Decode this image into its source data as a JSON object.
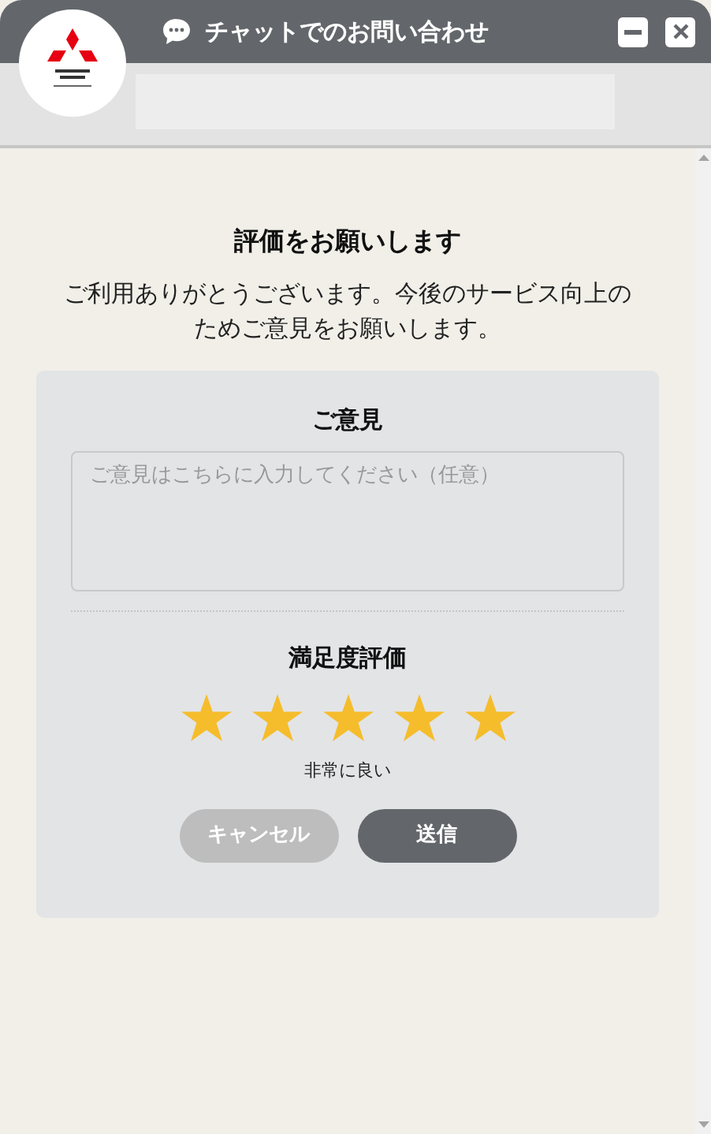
{
  "window": {
    "title": "チャットでのお問い合わせ"
  },
  "survey": {
    "title": "評価をお願いします",
    "description": "ご利用ありがとうございます。今後のサービス向上のためご意見をお願いします。",
    "feedback": {
      "label": "ご意見",
      "placeholder": "ご意見はこちらに入力してください（任意）"
    },
    "rating": {
      "label": "満足度評価",
      "stars": 5,
      "caption": "非常に良い"
    },
    "buttons": [
      {
        "label": "キャンセル",
        "kind": "cancel"
      },
      {
        "label": "送信",
        "kind": "submit"
      }
    ]
  }
}
